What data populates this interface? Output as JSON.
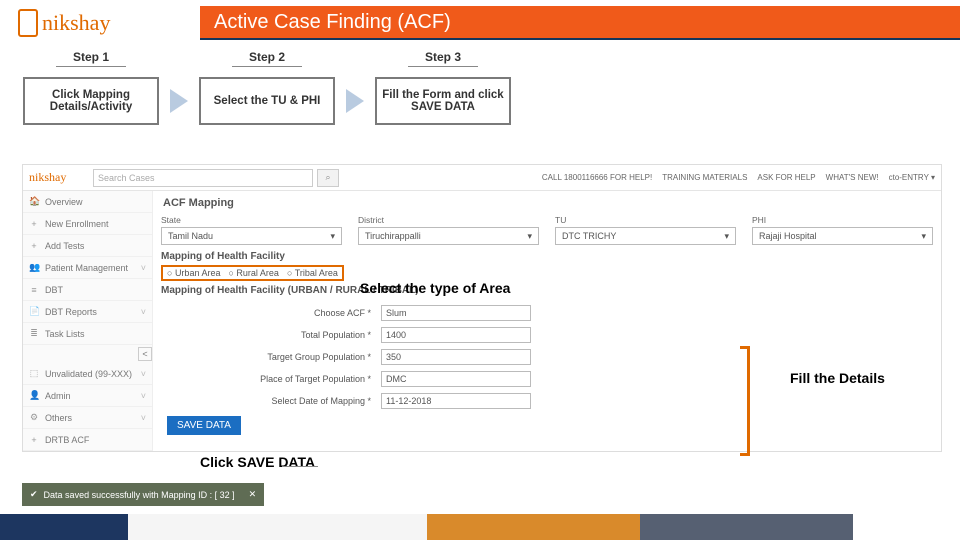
{
  "header": {
    "logo_text": "nikshay",
    "title": "Active Case Finding (ACF)"
  },
  "steps": [
    {
      "label": "Step 1",
      "text": "Click Mapping Details/Activity"
    },
    {
      "label": "Step 2",
      "text": "Select the TU & PHI"
    },
    {
      "label": "Step 3",
      "text": "Fill the Form and click SAVE DATA"
    }
  ],
  "screenshot": {
    "logo": "nikshay",
    "search_placeholder": "Search Cases",
    "search_icon": "⌕",
    "top_links": [
      "CALL 1800116666 FOR HELP!",
      "TRAINING MATERIALS",
      "ASK FOR HELP",
      "WHAT'S NEW!",
      "cto-ENTRY ▾"
    ],
    "sidebar": [
      {
        "icon": "🏠",
        "label": "Overview"
      },
      {
        "icon": "+",
        "label": "New Enrollment"
      },
      {
        "icon": "+",
        "label": "Add Tests"
      },
      {
        "icon": "👥",
        "label": "Patient Management",
        "caret": "˅"
      },
      {
        "icon": "≡",
        "label": "DBT"
      },
      {
        "icon": "📄",
        "label": "DBT Reports",
        "caret": "˅"
      },
      {
        "icon": "≣",
        "label": "Task Lists"
      },
      {
        "icon": "⬚",
        "label": "Unvalidated (99-XXX)",
        "caret": "˅"
      },
      {
        "icon": "👤",
        "label": "Admin",
        "caret": "˅"
      },
      {
        "icon": "⚙",
        "label": "Others",
        "caret": "˅"
      },
      {
        "icon": "+",
        "label": "DRTB ACF"
      }
    ],
    "collapse": "<",
    "main": {
      "heading": "ACF Mapping",
      "filters": {
        "state": {
          "label": "State",
          "value": "Tamil Nadu"
        },
        "district": {
          "label": "District",
          "value": "Tiruchirappalli"
        },
        "tu": {
          "label": "TU",
          "value": "DTC TRICHY"
        },
        "phi": {
          "label": "PHI",
          "value": "Rajaji Hospital"
        }
      },
      "map_h1": "Mapping of Health Facility",
      "area_options": [
        "Urban Area",
        "Rural Area",
        "Tribal Area"
      ],
      "map_h2": "Mapping of Health Facility (URBAN / RURAL / TRIBAL)",
      "fields": {
        "choose_acf": {
          "label": "Choose ACF *",
          "value": "Slum"
        },
        "total_pop": {
          "label": "Total Population *",
          "value": "1400"
        },
        "target_pop": {
          "label": "Target Group Population *",
          "value": "350"
        },
        "place_target": {
          "label": "Place of Target Population *",
          "value": "DMC"
        },
        "date_map": {
          "label": "Select Date of Mapping *",
          "value": "11-12-2018"
        }
      },
      "save_btn": "SAVE DATA"
    }
  },
  "toast": {
    "icon": "✔",
    "text": "Data saved successfully with Mapping ID : [ 32 ]",
    "close": "✕"
  },
  "callouts": {
    "area": "Select the type of Area",
    "fill": "Fill the Details",
    "save": "Click SAVE DATA"
  }
}
